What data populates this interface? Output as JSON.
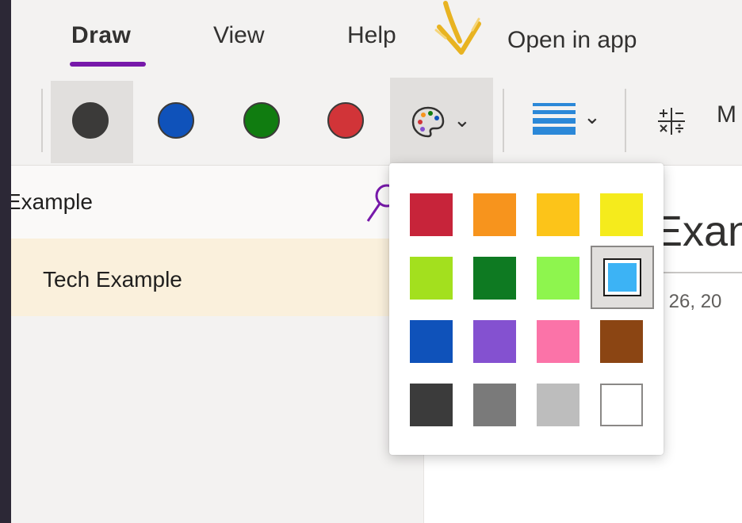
{
  "tabs": [
    {
      "label": "Draw"
    },
    {
      "label": "View"
    },
    {
      "label": "Help"
    }
  ],
  "open_in_app_label": "Open in app",
  "toolbar": {
    "pens": [
      {
        "name": "black-pen",
        "color": "#3b3a39"
      },
      {
        "name": "blue-pen",
        "color": "#0f52ba"
      },
      {
        "name": "green-pen",
        "color": "#107c10"
      },
      {
        "name": "red-pen",
        "color": "#d13438"
      }
    ],
    "palette_icon": "palette-icon",
    "thickness_icon": "stroke-thickness-icon",
    "math_icon": "math-icon",
    "math_label": "M"
  },
  "sidebar": {
    "title": "Example",
    "search_icon": "search-icon",
    "pages": [
      {
        "label": "Tech Example"
      }
    ]
  },
  "page": {
    "title": "Exan",
    "date": "y 26, 20"
  },
  "color_popup": {
    "selected_color": "#3cb3f5",
    "colors": [
      "#c7243a",
      "#f7941d",
      "#fcc419",
      "#f5eb1c",
      "#a3e01e",
      "#0e7a22",
      "#8ef54e",
      "#3cb3f5",
      "#0f52ba",
      "#8451d0",
      "#fb73a8",
      "#8b4513",
      "#3b3b3b",
      "#7a7a7a",
      "#bdbdbd",
      "#ffffff"
    ]
  }
}
